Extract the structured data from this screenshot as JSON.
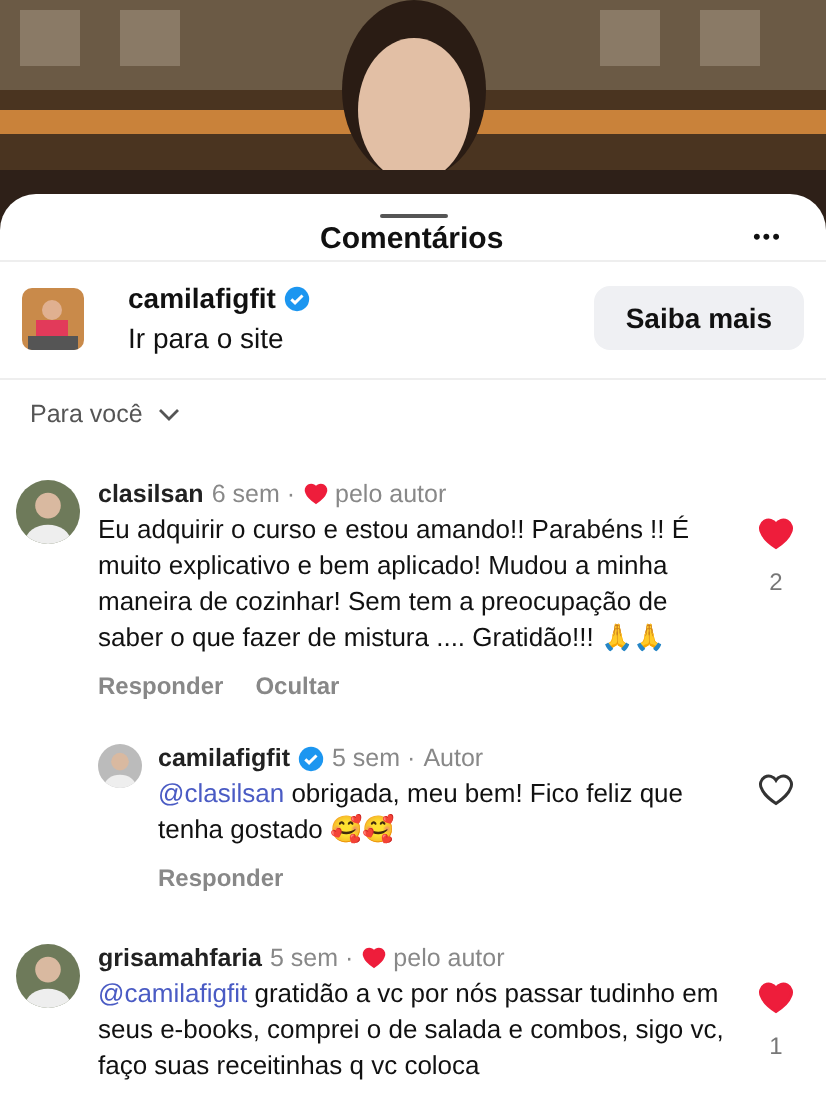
{
  "sheet": {
    "title": "Comentários",
    "more": "•••"
  },
  "ad": {
    "account": "camilafigfit",
    "verified": true,
    "subtitle": "Ir para o site",
    "button": "Saiba mais"
  },
  "sort": {
    "label": "Para você"
  },
  "comments": [
    {
      "user": "clasilsan",
      "time": "6 sem ·",
      "liked_by_author": true,
      "author_label": "pelo autor",
      "text": "Eu adquirir o curso e estou amando!! Parabéns !! É muito explicativo e bem aplicado! Mudou a minha maneira de cozinhar! Sem tem a preocupação de saber o que fazer de mistura .... Gratidão!!! 🙏🙏",
      "liked": true,
      "likes": "2",
      "actions": [
        "Responder",
        "Ocultar"
      ],
      "replies": [
        {
          "user": "camilafigfit",
          "verified": true,
          "time": "5 sem ·",
          "author_label": "Autor",
          "mention": "@clasilsan",
          "text": "obrigada, meu bem! Fico feliz que tenha gostado 🥰🥰",
          "liked": false,
          "actions": [
            "Responder"
          ]
        }
      ]
    },
    {
      "user": "grisamahfaria",
      "time": "5 sem ·",
      "liked_by_author": true,
      "author_label": "pelo autor",
      "mention": "@camilafigfit",
      "text": "gratidão a vc por nós passar tudinho em seus e-books, comprei o de salada e combos, sigo vc, faço suas receitinhas q vc coloca",
      "liked": true,
      "likes": "1"
    }
  ]
}
